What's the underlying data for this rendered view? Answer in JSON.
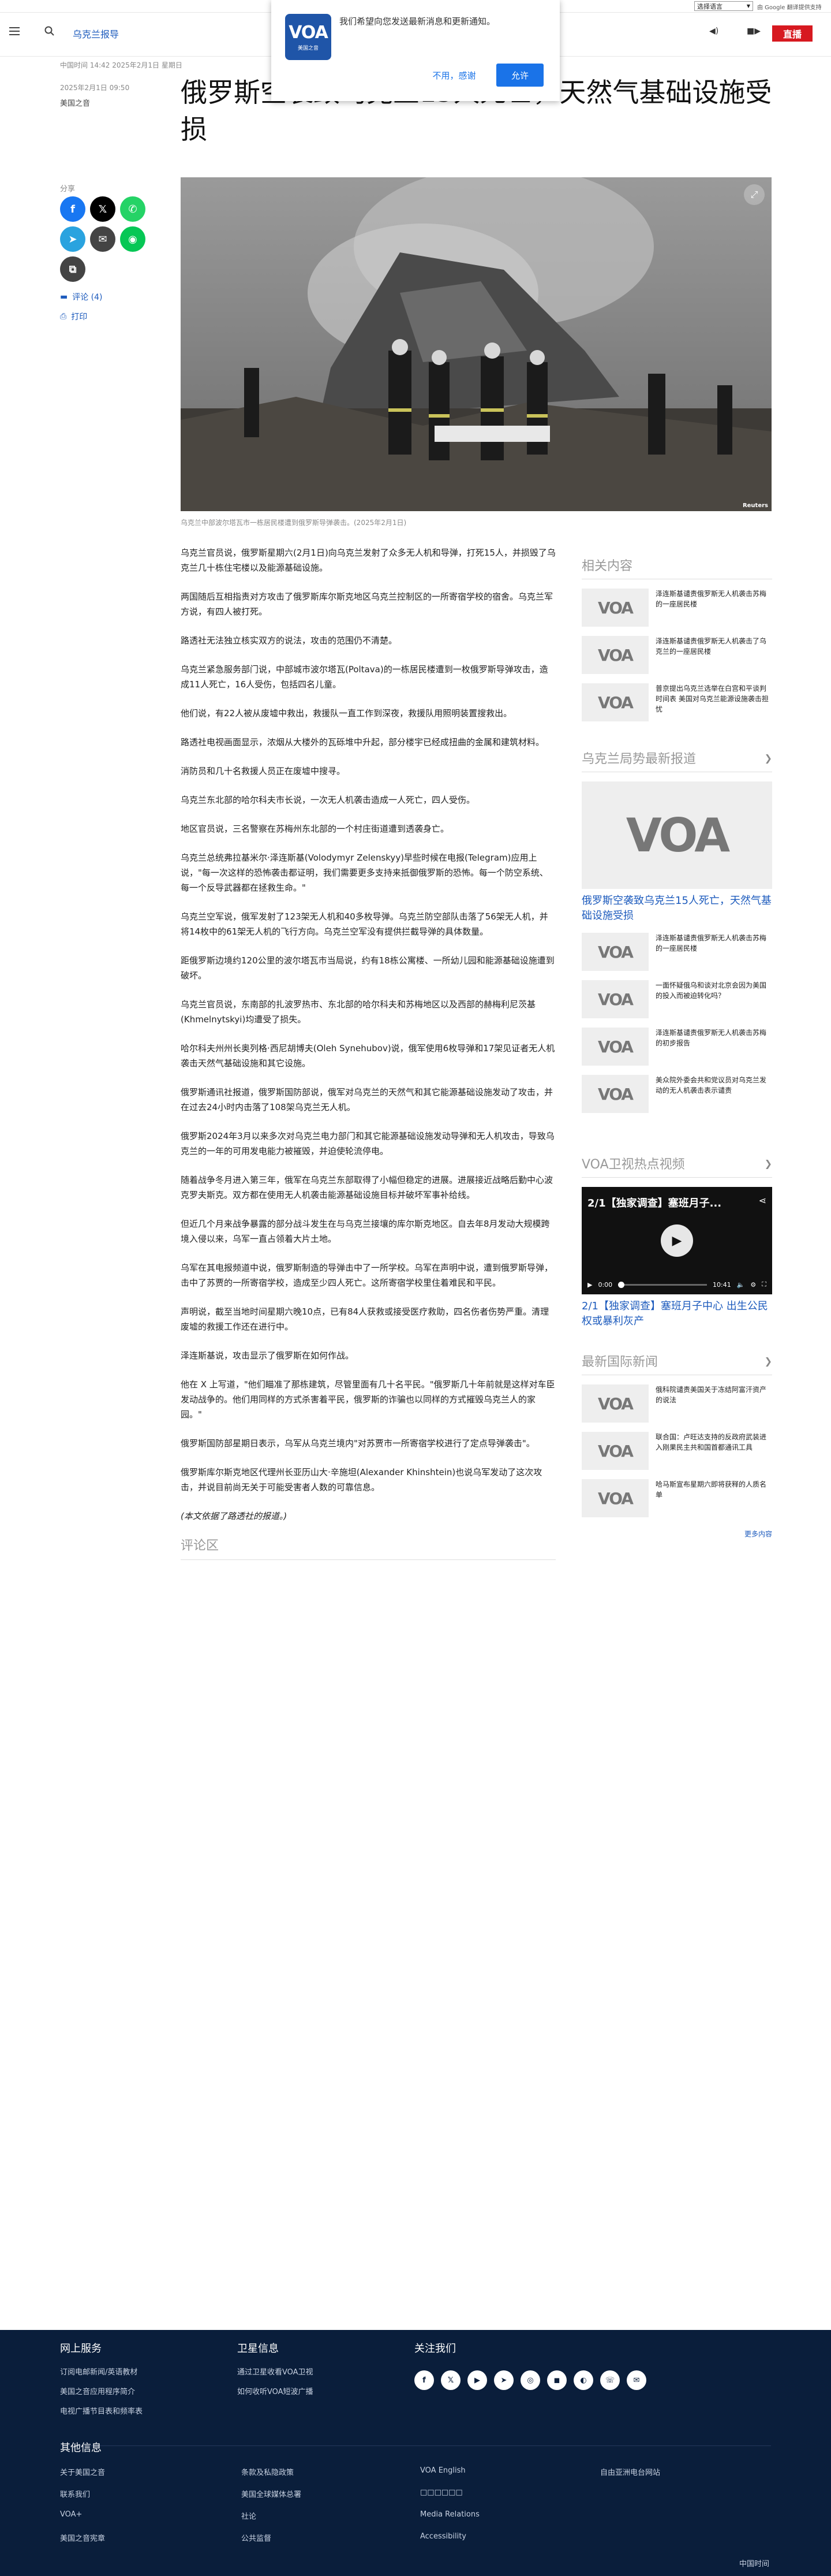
{
  "utility": {
    "language_select": "选择语言",
    "powered_by": "由 Google 翻译提供支持"
  },
  "header": {
    "section": "乌克兰报导",
    "live": "直播"
  },
  "notify": {
    "logo_text": "VOA",
    "logo_sub": "美国之音",
    "message": "我们希望向您发送最新消息和更新通知。",
    "decline": "不用，感谢",
    "accept": "允许"
  },
  "article": {
    "time_line": "中国时间 14:42 2025年2月1日 星期日",
    "date_line": "2025年2月1日 09:50",
    "author": "美国之音",
    "title": "俄罗斯空袭致乌克兰15人死亡，天然气基础设施受损",
    "caption": "乌克兰中部波尔塔瓦市一栋居民楼遭到俄罗斯导弹袭击。(2025年2月1日)",
    "image_credit": "Reuters",
    "paragraphs": [
      "乌克兰官员说，俄罗斯星期六(2月1日)向乌克兰发射了众多无人机和导弹，打死15人，并损毁了乌克兰几十栋住宅楼以及能源基础设施。",
      "两国随后互相指责对方攻击了俄罗斯库尔斯克地区乌克兰控制区的一所寄宿学校的宿舍。乌克兰军方说，有四人被打死。",
      "路透社无法独立核实双方的说法，攻击的范围仍不清楚。",
      "乌克兰紧急服务部门说，中部城市波尔塔瓦(Poltava)的一栋居民楼遭到一枚俄罗斯导弹攻击，造成11人死亡，16人受伤，包括四名儿童。",
      "他们说，有22人被从废墟中救出，救援队一直工作到深夜，救援队用照明装置搜救出。",
      "路透社电视画面显示，浓烟从大楼外的瓦砾堆中升起，部分楼宇已经成扭曲的金属和建筑材料。",
      "消防员和几十名救援人员正在废墟中搜寻。",
      "乌克兰东北部的哈尔科夫市长说，一次无人机袭击造成一人死亡，四人受伤。",
      "地区官员说，三名警察在苏梅州东北部的一个村庄街道遭到透袭身亡。",
      "乌克兰总统弗拉基米尔·泽连斯基(Volodymyr Zelenskyy)早些时候在电报(Telegram)应用上说，\"每一次这样的恐怖袭击都证明，我们需要更多支持来抵御俄罗斯的恐怖。每一个防空系统、每一个反导武器都在拯救生命。\"",
      "乌克兰空军说，俄军发射了123架无人机和40多枚导弹。乌克兰防空部队击落了56架无人机，并将14枚中的61架无人机的飞行方向。乌克兰空军没有提供拦截导弹的具体数量。",
      "距俄罗斯边境约120公里的波尔塔瓦市当局说，约有18栋公寓楼、一所幼儿园和能源基础设施遭到破坏。",
      "乌克兰官员说，东南部的扎波罗热市、东北部的哈尔科夫和苏梅地区以及西部的赫梅利尼茨基(Khmelnytskyi)均遭受了损失。",
      "哈尔科夫州州长奥列格·西尼胡博夫(Oleh Synehubov)说，俄军使用6枚导弹和17架见证者无人机袭击天然气基础设施和其它设施。",
      "俄罗斯通讯社报道，俄罗斯国防部说，俄军对乌克兰的天然气和其它能源基础设施发动了攻击，并在过去24小时内击落了108架乌克兰无人机。",
      "俄罗斯2024年3月以来多次对乌克兰电力部门和其它能源基础设施发动导弹和无人机攻击，导致乌克兰的一年的可用发电能力被摧毁，并迫使轮流停电。",
      "随着战争冬月进入第三年，俄军在乌克兰东部取得了小幅但稳定的进展。进展接近战略后勤中心波克罗夫斯克。双方都在使用无人机袭击能源基础设施目标并破坏军事补给线。",
      "但近几个月来战争暴露的部分战斗发生在与乌克兰接壤的库尔斯克地区。自去年8月发动大规模跨境入侵以来，乌军一直占领着大片土地。",
      "乌军在其电报频道中说，俄罗斯制造的导弹击中了一所学校。乌军在声明中说，遭到俄罗斯导弹，击中了苏贾的一所寄宿学校，造成至少四人死亡。这所寄宿学校里住着难民和平民。",
      "声明说，截至当地时间星期六晚10点，已有84人获救或接受医疗救助，四名伤者伤势严重。清理废墟的救援工作还在进行中。",
      "泽连斯基说，攻击显示了俄罗斯在如何作战。",
      "他在 X 上写道，\"他们瞄准了那栋建筑，尽管里面有几十名平民。\"俄罗斯几十年前就是这样对车臣发动战争的。他们用同样的方式杀害着平民，俄罗斯的诈骗也以同样的方式摧毁乌克兰人的家园。\"",
      "俄罗斯国防部星期日表示，乌军从乌克兰境内\"对苏贾市一所寄宿学校进行了定点导弹袭击\"。",
      "俄罗斯库尔斯克地区代理州长亚历山大·辛施坦(Alexander Khinshtein)也说乌军发动了这次攻击，并说目前尚无关于可能受害者人数的可靠信息。",
      "(本文依据了路透社的报道。)"
    ],
    "comments_title": "评论区"
  },
  "share": {
    "label": "分享",
    "buttons": [
      {
        "name": "facebook-share-button",
        "glyph": "f",
        "color": "#1877f2"
      },
      {
        "name": "x-share-button",
        "glyph": "𝕏",
        "color": "#000000"
      },
      {
        "name": "whatsapp-share-button",
        "glyph": "✆",
        "color": "#25d366"
      },
      {
        "name": "telegram-share-button",
        "glyph": "➤",
        "color": "#2aa3df"
      },
      {
        "name": "email-share-button",
        "glyph": "✉",
        "color": "#444444"
      },
      {
        "name": "line-share-button",
        "glyph": "◉",
        "color": "#06c755"
      },
      {
        "name": "copy-link-button",
        "glyph": "⧉",
        "color": "#444444"
      }
    ],
    "comments_link": "评论 (4)",
    "print_link": "打印"
  },
  "sidebar": {
    "related_title": "相关内容",
    "related": [
      "泽连斯基谴责俄罗斯无人机袭击苏梅的一座居民楼",
      "泽连斯基谴责俄罗斯无人机袭击了乌克兰的一座居民楼",
      "普京提出乌克兰选举在白宫和平谈判时间表 美国对乌克兰能源设施袭击担忧"
    ],
    "latest_title": "乌克兰局势最新报道",
    "latest_feature": "俄罗斯空袭致乌克兰15人死亡，天然气基础设施受损",
    "latest": [
      "泽连斯基谴责俄罗斯无人机袭击苏梅的一座居民楼",
      "一面怀疑俄乌和谈对北京会因为美国的投入而被迫转化吗？",
      "泽连斯基谴责俄罗斯无人机袭击苏梅的初步报告",
      "美众院外委会共和党议员对乌克兰发动的无人机袭击表示谴责"
    ],
    "video_section_title": "VOA卫视热点视频",
    "video_overlay_title": "2/1【独家调查】塞班月子...",
    "video_time_current": "0:00",
    "video_time_total": "10:41",
    "video_caption": "2/1【独家调查】塞班月子中心 出生公民权或暴利灰产",
    "intl_title": "最新国际新闻",
    "intl": [
      "俄科院谴责美国关于冻结阿富汗资产的说法",
      "联合国：卢旺达支持的反政府武装进入刚果民主共和国首都通讯工具",
      "哈马斯宣布星期六即将获释的人质名单"
    ],
    "more": "更多内容"
  },
  "footer": {
    "col1_title": "网上服务",
    "col1_links": [
      "订阅电邮新闻/英语教材",
      "美国之音应用程序简介",
      "电视广播节目表和频率表"
    ],
    "col2_title": "卫星信息",
    "col2_links": [
      "通过卫星收看VOA卫视",
      "如何收听VOA短波广播"
    ],
    "col3_title": "关注我们",
    "socials": [
      "f",
      "𝕏",
      "▶",
      "➤",
      "◎",
      "◼",
      "◐",
      "☏",
      "✉"
    ],
    "other_title": "其他信息",
    "other_links": [
      [
        "关于美国之音",
        "条款及私隐政策",
        "VOA English",
        "自由亚洲电台网站"
      ],
      [
        "联系我们",
        "美国全球媒体总署",
        "□□□□□□",
        ""
      ],
      [
        "VOA+",
        "社论",
        "Media Relations",
        ""
      ],
      [
        "美国之音宪章",
        "公共监督",
        "Accessibility",
        ""
      ]
    ],
    "copyright": "中国时间"
  },
  "colors": {
    "brand_blue": "#1d5bbd",
    "live_red": "#d71920",
    "footer_navy": "#0a1e3b"
  }
}
